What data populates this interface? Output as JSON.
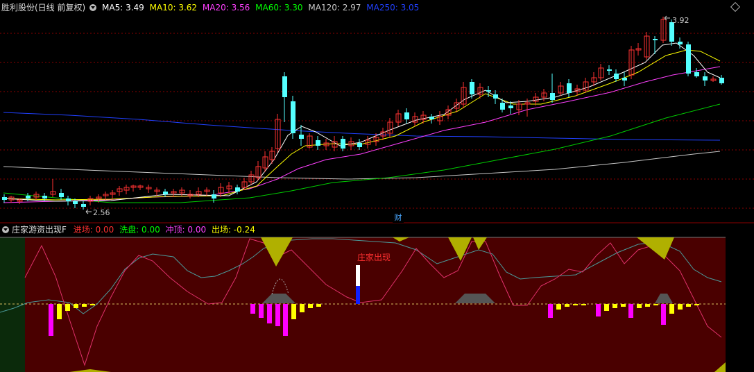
{
  "header": {
    "stock_title": "胜利股份(日线 前复权)",
    "ma": [
      {
        "label": "MA5: 3.49",
        "color": "#ffffff"
      },
      {
        "label": "MA10: 3.62",
        "color": "#ffff00"
      },
      {
        "label": "MA20: 3.56",
        "color": "#ff40ff"
      },
      {
        "label": "MA60: 3.30",
        "color": "#00ff00"
      },
      {
        "label": "MA120: 2.97",
        "color": "#c8c8c8"
      },
      {
        "label": "MA250: 3.05",
        "color": "#2040ff"
      }
    ]
  },
  "main_chart": {
    "high_note": "3.92",
    "low_note": "2.56",
    "finance_badge": "财"
  },
  "indicator": {
    "name": "庄家游资出现F",
    "fields": [
      {
        "label": "进场: 0.00",
        "color": "#ff3030"
      },
      {
        "label": "洗盘: 0.00",
        "color": "#00ff00"
      },
      {
        "label": "冲顶: 0.00",
        "color": "#ff40ff"
      },
      {
        "label": "出场: -0.24",
        "color": "#ffff00"
      }
    ],
    "signal_text": "庄家出现"
  },
  "colors": {
    "up": "#ff3232",
    "down": "#54ffff",
    "grid": "#8b0000",
    "panel_bg": "#4a0000",
    "panel_left": "#0b2a0b"
  }
}
